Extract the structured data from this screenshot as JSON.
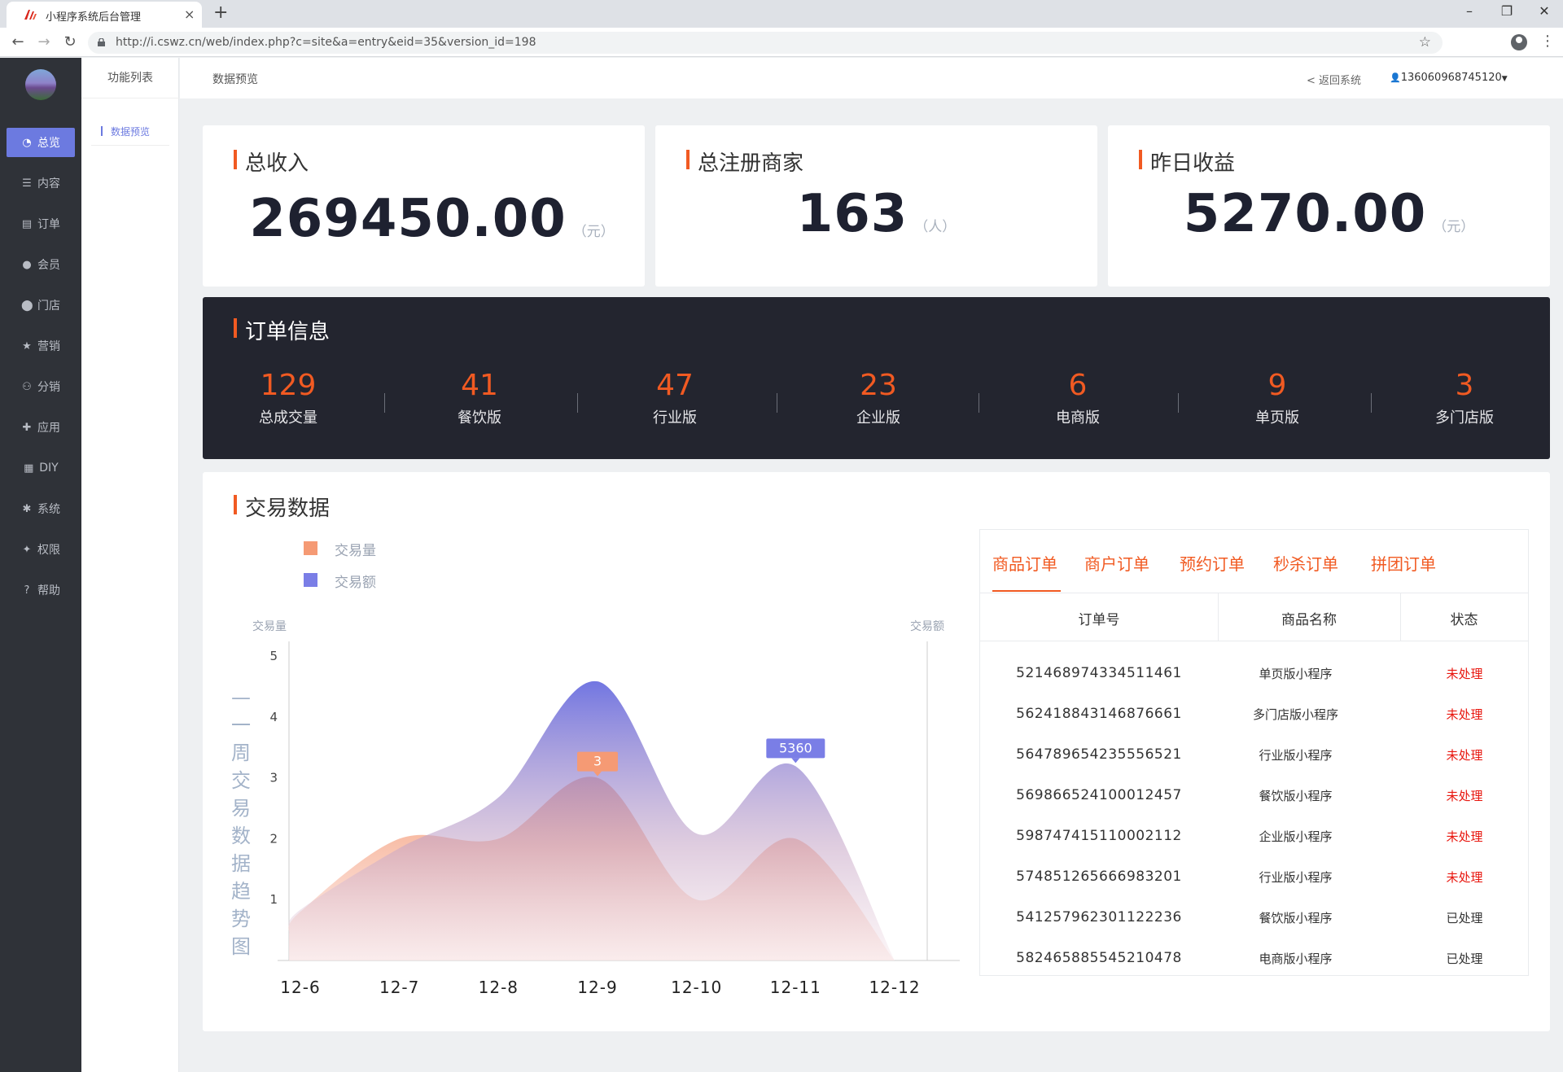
{
  "browser": {
    "tab_title": "小程序系统后台管理",
    "url": "http://i.cswz.cn/web/index.php?c=site&a=entry&eid=35&version_id=198"
  },
  "sidebar": {
    "items": [
      {
        "label": "总览",
        "icon": "pie-chart-icon",
        "glyph": "◔",
        "active": true
      },
      {
        "label": "内容",
        "icon": "list-icon",
        "glyph": "☰",
        "active": false
      },
      {
        "label": "订单",
        "icon": "document-icon",
        "glyph": "▤",
        "active": false
      },
      {
        "label": "会员",
        "icon": "user-icon",
        "glyph": "●",
        "active": false
      },
      {
        "label": "门店",
        "icon": "map-marker-icon",
        "glyph": "⬤",
        "active": false
      },
      {
        "label": "营销",
        "icon": "star-icon",
        "glyph": "★",
        "active": false
      },
      {
        "label": "分销",
        "icon": "users-icon",
        "glyph": "⚇",
        "active": false
      },
      {
        "label": "应用",
        "icon": "puzzle-icon",
        "glyph": "✚",
        "active": false
      },
      {
        "label": "DIY",
        "icon": "layout-icon",
        "glyph": "▦",
        "active": false
      },
      {
        "label": "系统",
        "icon": "gear-icon",
        "glyph": "✱",
        "active": false
      },
      {
        "label": "权限",
        "icon": "user-add-icon",
        "glyph": "✦",
        "active": false
      },
      {
        "label": "帮助",
        "icon": "question-icon",
        "glyph": "?",
        "active": false
      }
    ]
  },
  "subnav": {
    "title": "功能列表",
    "item": "数据预览"
  },
  "header": {
    "breadcrumb": "数据预览",
    "back_link": "< 返回系统",
    "user": "136060968745120"
  },
  "stats": [
    {
      "title": "总收入",
      "value": "269450.00",
      "unit": "（元）"
    },
    {
      "title": "总注册商家",
      "value": "163",
      "unit": "（人）"
    },
    {
      "title": "昨日收益",
      "value": "5270.00",
      "unit": "（元）"
    }
  ],
  "order_info": {
    "title": "订单信息",
    "items": [
      {
        "value": "129",
        "label": "总成交量"
      },
      {
        "value": "41",
        "label": "餐饮版"
      },
      {
        "value": "47",
        "label": "行业版"
      },
      {
        "value": "23",
        "label": "企业版"
      },
      {
        "value": "6",
        "label": "电商版"
      },
      {
        "value": "9",
        "label": "单页版"
      },
      {
        "value": "3",
        "label": "多门店版"
      }
    ]
  },
  "trade": {
    "title": "交易数据",
    "vertical_title": "一周交易数据趋势图"
  },
  "chart_data": {
    "type": "area",
    "title": "一周交易数据趋势图",
    "x": [
      "12-6",
      "12-7",
      "12-8",
      "12-9",
      "12-10",
      "12-11",
      "12-12"
    ],
    "ylabel_left": "交易量",
    "ylabel_right": "交易额",
    "ylim_left": [
      0,
      5
    ],
    "yticks_left": [
      "1",
      "2",
      "3",
      "4",
      "5"
    ],
    "series": [
      {
        "name": "交易量",
        "color": "#f59a74",
        "values": [
          0.8,
          2,
          2,
          3,
          1,
          2,
          0
        ]
      },
      {
        "name": "交易额",
        "color": "#7a7ee6",
        "values": [
          1400,
          3100,
          4500,
          7700,
          3500,
          5360,
          0
        ]
      }
    ],
    "annotations": [
      {
        "series": "交易量",
        "x": "12-9",
        "text": "3"
      },
      {
        "series": "交易额",
        "x": "12-11",
        "text": "5360"
      }
    ],
    "legend": "top-left",
    "grid": false
  },
  "orders": {
    "tabs": [
      "商品订单",
      "商户订单",
      "预约订单",
      "秒杀订单",
      "拼团订单"
    ],
    "columns": [
      "订单号",
      "商品名称",
      "状态"
    ],
    "rows": [
      {
        "no": "521468974334511461",
        "name": "单页版小程序",
        "status": "未处理",
        "pending": true
      },
      {
        "no": "562418843146876661",
        "name": "多门店版小程序",
        "status": "未处理",
        "pending": true
      },
      {
        "no": "564789654235556521",
        "name": "行业版小程序",
        "status": "未处理",
        "pending": true
      },
      {
        "no": "569866524100012457",
        "name": "餐饮版小程序",
        "status": "未处理",
        "pending": true
      },
      {
        "no": "598747415110002112",
        "name": "企业版小程序",
        "status": "未处理",
        "pending": true
      },
      {
        "no": "574851265666983201",
        "name": "行业版小程序",
        "status": "未处理",
        "pending": true
      },
      {
        "no": "541257962301122236",
        "name": "餐饮版小程序",
        "status": "已处理",
        "pending": false
      },
      {
        "no": "582465885545210478",
        "name": "电商版小程序",
        "status": "已处理",
        "pending": false
      }
    ]
  },
  "colors": {
    "accent": "#f15a22",
    "active_nav": "#6c7ae0",
    "sidebar_bg": "#2f3238",
    "order_panel_bg": "#23252f",
    "pending_status": "#e8160e"
  }
}
